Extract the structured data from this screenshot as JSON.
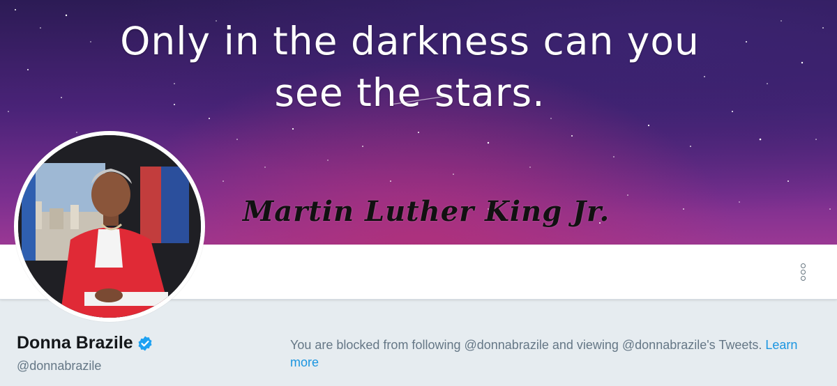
{
  "banner": {
    "quote_line1": "Only in the darkness can you",
    "quote_line2": "see the stars.",
    "attribution": "Martin Luther King Jr."
  },
  "profile": {
    "display_name": "Donna Brazile",
    "screen_name": "@donnabrazile",
    "verified": true,
    "verified_color": "#1da1f2"
  },
  "navbar": {
    "more_icon": "vertical-ellipsis-icon"
  },
  "blocked_notice": {
    "text": "You are blocked from following @donnabrazile and viewing @donnabrazile's Tweets. ",
    "link_label": "Learn more",
    "link_color": "#1b95e0"
  },
  "colors": {
    "page_background": "#e6ecf0",
    "name_color": "#14171a",
    "muted_text": "#657786"
  }
}
